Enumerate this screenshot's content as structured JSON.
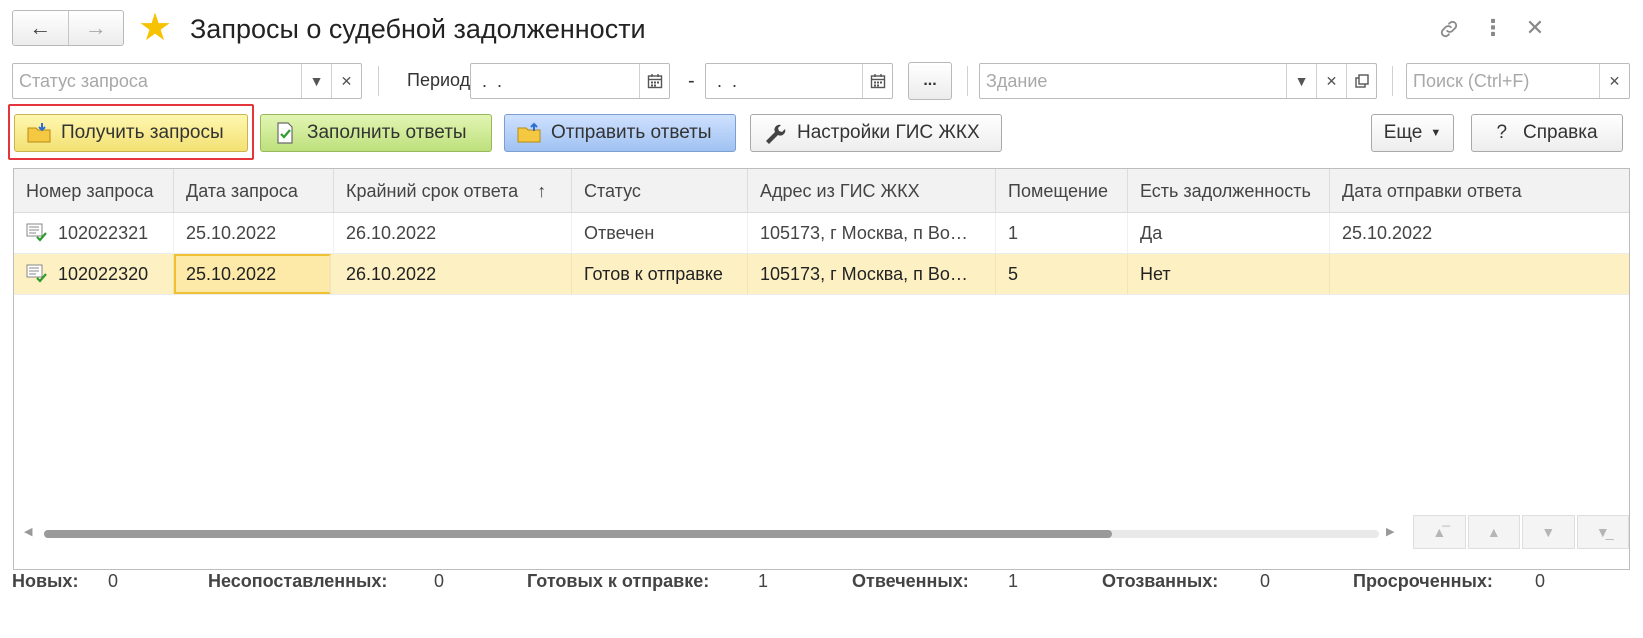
{
  "window": {
    "title": "Запросы о судебной задолженности"
  },
  "filters": {
    "status_placeholder": "Статус запроса",
    "period_label": "Период:",
    "period_from": " .  .",
    "period_to": " .  .",
    "period_dash": "-",
    "more_label": "...",
    "building_placeholder": "Здание",
    "search_placeholder": "Поиск (Ctrl+F)"
  },
  "toolbar": {
    "get_requests": "Получить запросы",
    "fill_answers": "Заполнить ответы",
    "send_answers": "Отправить ответы",
    "gis_settings": "Настройки ГИС ЖКХ",
    "more": "Еще",
    "help": "Справка",
    "help_glyph": "?"
  },
  "table": {
    "columns": [
      "Номер запроса",
      "Дата запроса",
      "Крайний срок ответа",
      "Статус",
      "Адрес из ГИС ЖКХ",
      "Помещение",
      "Есть задолженность",
      "Дата отправки ответа"
    ],
    "sort_indicator": "↑",
    "rows": [
      {
        "number": "102022321",
        "date": "25.10.2022",
        "deadline": "26.10.2022",
        "status": "Отвечен",
        "address": "105173, г Москва, п Во…",
        "room": "1",
        "debt": "Да",
        "sent_date": "25.10.2022"
      },
      {
        "number": "102022320",
        "date": "25.10.2022",
        "deadline": "26.10.2022",
        "status": "Готов к отправке",
        "address": "105173, г Москва, п Во…",
        "room": "5",
        "debt": "Нет",
        "sent_date": ""
      }
    ],
    "scroll_position": 0.8
  },
  "stats": {
    "new_label": "Новых:",
    "new_value": "0",
    "unmatched_label": "Несопоставленных:",
    "unmatched_value": "0",
    "ready_label": "Готовых к отправке:",
    "ready_value": "1",
    "answered_label": "Отвеченных:",
    "answered_value": "1",
    "recalled_label": "Отозванных:",
    "recalled_value": "0",
    "overdue_label": "Просроченных:",
    "overdue_value": "0"
  },
  "colors": {
    "accent_yellow": "#f3e173",
    "accent_green": "#bde07c",
    "accent_blue": "#9fc2f2",
    "selection": "#fdf1c4",
    "highlight_red": "#e2353c"
  }
}
